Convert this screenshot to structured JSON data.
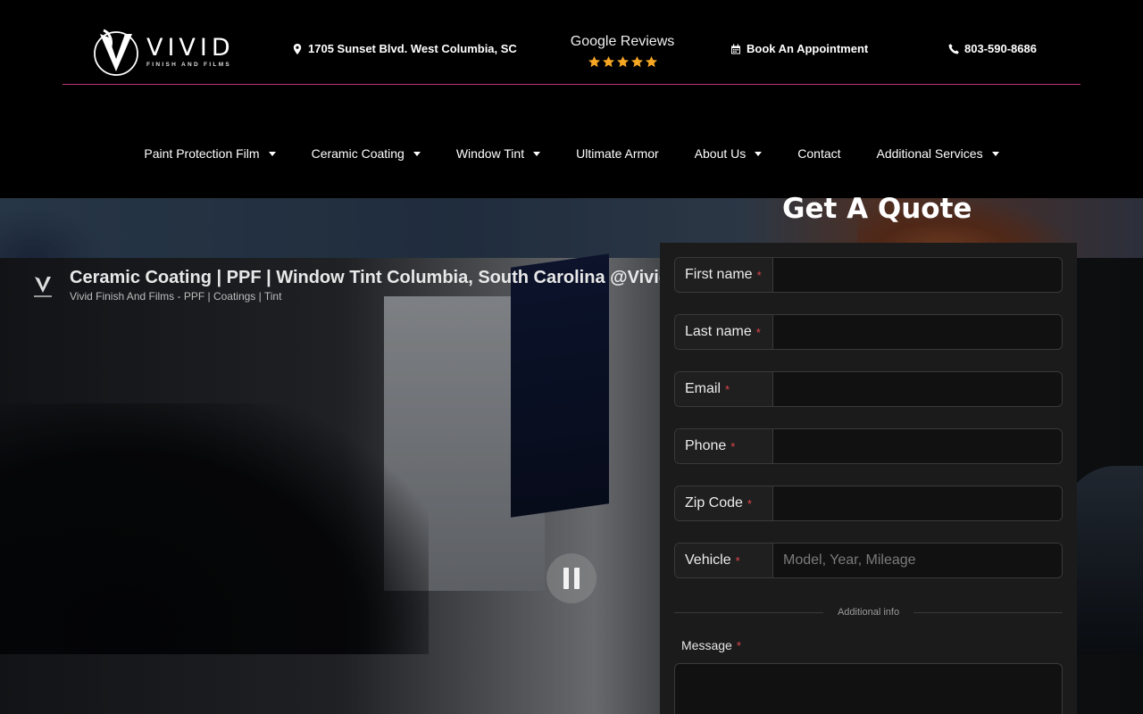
{
  "brand": {
    "name": "VIVID",
    "tagline": "FINISH AND FILMS"
  },
  "header": {
    "address": "1705 Sunset Blvd. West Columbia, SC",
    "reviews_label": "Google Reviews",
    "rating_stars": 5,
    "book_label": "Book An Appointment",
    "phone": "803-590-8686",
    "accent_color": "#c0337a",
    "star_color": "#f5a623"
  },
  "nav": {
    "items": [
      {
        "label": "Paint Protection Film",
        "has_dropdown": true
      },
      {
        "label": "Ceramic Coating",
        "has_dropdown": true
      },
      {
        "label": "Window Tint",
        "has_dropdown": true
      },
      {
        "label": "Ultimate Armor",
        "has_dropdown": false
      },
      {
        "label": "About Us",
        "has_dropdown": true
      },
      {
        "label": "Contact",
        "has_dropdown": false
      },
      {
        "label": "Additional Services",
        "has_dropdown": true
      }
    ]
  },
  "video": {
    "title": "Ceramic Coating | PPF | Window Tint Columbia, South Carolina @Vivid Finish and Films",
    "channel": "Vivid Finish And Films - PPF | Coatings | Tint",
    "state": "playing"
  },
  "quote": {
    "title": "Get A Quote",
    "required_marker": "*",
    "fields": [
      {
        "label": "First name",
        "value": "",
        "placeholder": ""
      },
      {
        "label": "Last name",
        "value": "",
        "placeholder": ""
      },
      {
        "label": "Email",
        "value": "",
        "placeholder": ""
      },
      {
        "label": "Phone",
        "value": "",
        "placeholder": ""
      },
      {
        "label": "Zip Code",
        "value": "",
        "placeholder": ""
      },
      {
        "label": "Vehicle",
        "value": "",
        "placeholder": "Model, Year, Mileage"
      }
    ],
    "divider_label": "Additional info",
    "message_label": "Message",
    "message_value": ""
  }
}
